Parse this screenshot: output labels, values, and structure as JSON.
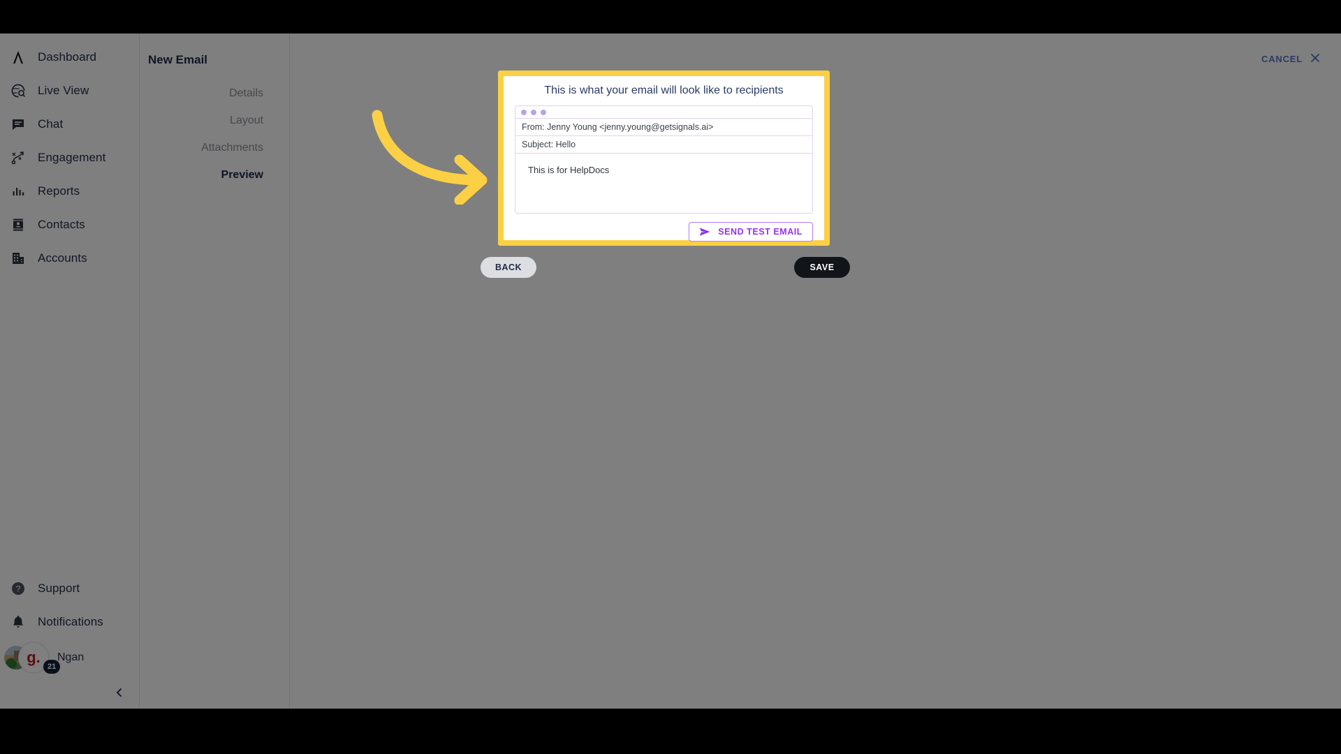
{
  "theme": {
    "accent_yellow": "#fbd044",
    "accent_purple": "#9333ea",
    "navy": "#1d2b46",
    "overlay": "rgba(0,0,0,0.5)"
  },
  "sidebar": {
    "logo_icon": "lambda-logo-icon",
    "items": [
      {
        "label": "Dashboard",
        "icon": "lambda-logo-icon"
      },
      {
        "label": "Live View",
        "icon": "globe-search-icon"
      },
      {
        "label": "Chat",
        "icon": "chat-bubble-icon"
      },
      {
        "label": "Engagement",
        "icon": "engagement-flow-icon"
      },
      {
        "label": "Reports",
        "icon": "bar-chart-icon"
      },
      {
        "label": "Contacts",
        "icon": "contact-card-icon"
      },
      {
        "label": "Accounts",
        "icon": "building-icon"
      }
    ],
    "bottom_items": [
      {
        "label": "Support",
        "icon": "help-circle-icon"
      },
      {
        "label": "Notifications",
        "icon": "bell-icon"
      }
    ],
    "profile": {
      "name": "Ngan",
      "org_initial": "g.",
      "badge_count": "21",
      "avatar_icon": "avatar"
    },
    "collapse_icon": "chevron-left-icon"
  },
  "wizard": {
    "title": "New Email",
    "steps": [
      {
        "label": "Details",
        "active": false
      },
      {
        "label": "Layout",
        "active": false
      },
      {
        "label": "Attachments",
        "active": false
      },
      {
        "label": "Preview",
        "active": true
      }
    ]
  },
  "header": {
    "cancel_label": "CANCEL",
    "close_icon": "close-icon"
  },
  "dialog": {
    "heading": "This is what your email will look like to recipients",
    "mail": {
      "from": "From: Jenny Young <jenny.young@getsignals.ai>",
      "subject": "Subject: Hello",
      "body": "This is for HelpDocs",
      "window_dots": 3
    },
    "send_test_label": "SEND TEST EMAIL",
    "send_icon": "paper-plane-icon"
  },
  "footer": {
    "back_label": "BACK",
    "save_label": "SAVE"
  },
  "annotation": {
    "arrow_icon": "curved-arrow-right-icon",
    "arrow_color": "#fbd044"
  }
}
